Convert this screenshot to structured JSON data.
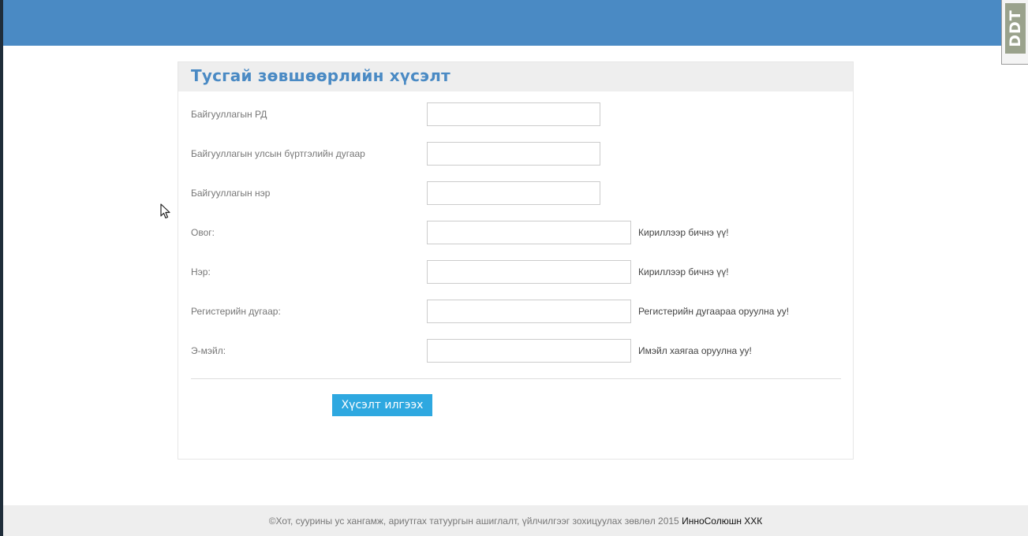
{
  "header": {
    "badge_text": "DDT",
    "bar_color": "#4a8ac4"
  },
  "form": {
    "title": "Тусгай зөвшөөрлийн хүсэлт",
    "fields": [
      {
        "label": "Байгууллагын РД",
        "value": "",
        "hint": ""
      },
      {
        "label": "Байгууллагын улсын бүртгэлийн дугаар",
        "value": "",
        "hint": ""
      },
      {
        "label": "Байгууллагын нэр",
        "value": "",
        "hint": ""
      },
      {
        "label": "Овог:",
        "value": "",
        "hint": "Кириллээр бичнэ үү!"
      },
      {
        "label": "Нэр:",
        "value": "",
        "hint": "Кириллээр бичнэ үү!"
      },
      {
        "label": "Регистерийн дугаар:",
        "value": "",
        "hint": "Регистерийн дугаараа оруулна уу!"
      },
      {
        "label": "Э-мэйл:",
        "value": "",
        "hint": "Имэйл хаягаа оруулна уу!"
      }
    ],
    "submit_label": "Хүсэлт илгээх",
    "button_color": "#2ea8e0"
  },
  "footer": {
    "text": "©Хот, суурины ус хангамж, ариутгах татуургын ашиглалт, үйлчилгээг зохицуулах зөвлөл 2015",
    "link_text": "ИнноСолюшн ХХК"
  }
}
